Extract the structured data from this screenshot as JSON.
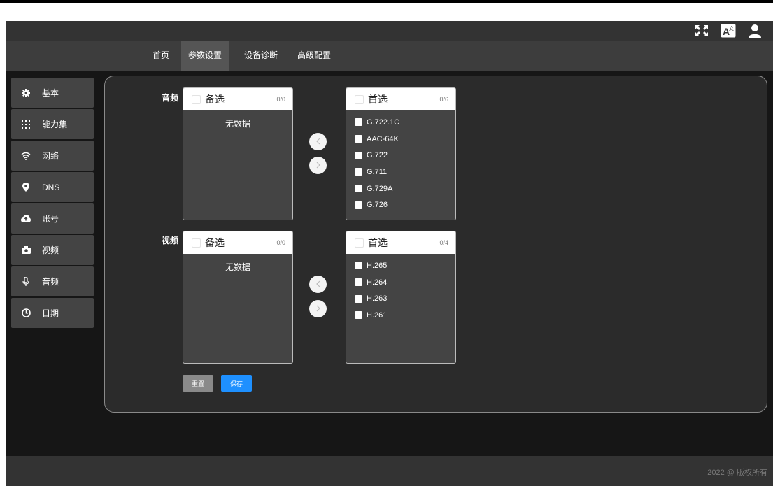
{
  "header": {
    "icons": [
      "fullscreen-icon",
      "translate-icon",
      "user-icon"
    ],
    "translate_glyph": "A",
    "translate_sub": "文"
  },
  "nav": {
    "tabs": [
      {
        "label": "首页",
        "active": false
      },
      {
        "label": "参数设置",
        "active": true
      },
      {
        "label": "设备诊断",
        "active": false
      },
      {
        "label": "高级配置",
        "active": false
      }
    ]
  },
  "sidebar": {
    "items": [
      {
        "label": "基本",
        "icon": "gear-icon"
      },
      {
        "label": "能力集",
        "icon": "grid-icon"
      },
      {
        "label": "网络",
        "icon": "wifi-icon"
      },
      {
        "label": "DNS",
        "icon": "location-pin-icon"
      },
      {
        "label": "账号",
        "icon": "cloud-upload-icon"
      },
      {
        "label": "视频",
        "icon": "camera-icon"
      },
      {
        "label": "音频",
        "icon": "microphone-icon"
      },
      {
        "label": "日期",
        "icon": "clock-icon"
      }
    ]
  },
  "audio": {
    "label": "音频",
    "left": {
      "title": "备选",
      "count": "0/0",
      "empty": "无数据"
    },
    "right": {
      "title": "首选",
      "count": "0/6",
      "items": [
        "G.722.1C",
        "AAC-64K",
        "G.722",
        "G.711",
        "G.729A",
        "G.726"
      ]
    }
  },
  "video": {
    "label": "视频",
    "left": {
      "title": "备选",
      "count": "0/0",
      "empty": "无数据"
    },
    "right": {
      "title": "首选",
      "count": "0/4",
      "items": [
        "H.265",
        "H.264",
        "H.263",
        "H.261"
      ]
    }
  },
  "buttons": {
    "reset": "重置",
    "save": "保存"
  },
  "colors": {
    "accent": "#1e90ff",
    "reset": "#8a8a8a"
  },
  "footer": {
    "copyright": "2022 @ 版权所有"
  }
}
